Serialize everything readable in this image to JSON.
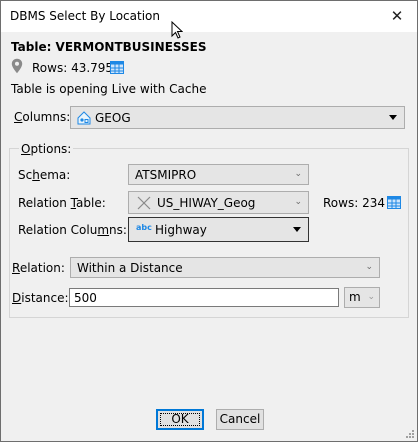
{
  "window": {
    "title": "DBMS Select By Location",
    "close_glyph": "✕"
  },
  "table": {
    "label": "Table: VERMONTBUSINESSES",
    "rows": "Rows: 43.795",
    "status": "Table is opening Live with Cache"
  },
  "columns": {
    "label_u": "C",
    "label_rest": "olumns:",
    "value": "GEOG"
  },
  "options": {
    "legend_u": "O",
    "legend_rest": "ptions:",
    "schema": {
      "label_pre": "Sc",
      "label_u": "h",
      "label_post": "ema:",
      "value": "ATSMIPRO"
    },
    "relation_table": {
      "label_pre": "Relation ",
      "label_u": "T",
      "label_post": "able:",
      "value": "US_HIWAY_Geog",
      "rows": "Rows: 234"
    },
    "relation_columns": {
      "label_pre": "Relation Colu",
      "label_u": "m",
      "label_post": "ns:",
      "abc": "abc",
      "value": "Highway"
    }
  },
  "relation": {
    "label_u": "R",
    "label_rest": "elation:",
    "value": "Within a Distance"
  },
  "distance": {
    "label_u": "D",
    "label_rest": "istance:",
    "value": "500",
    "unit": "m"
  },
  "buttons": {
    "ok": "OK",
    "cancel": "Cancel"
  },
  "colors": {
    "accent": "#0078d7",
    "table_icon": "#1e88e5"
  }
}
